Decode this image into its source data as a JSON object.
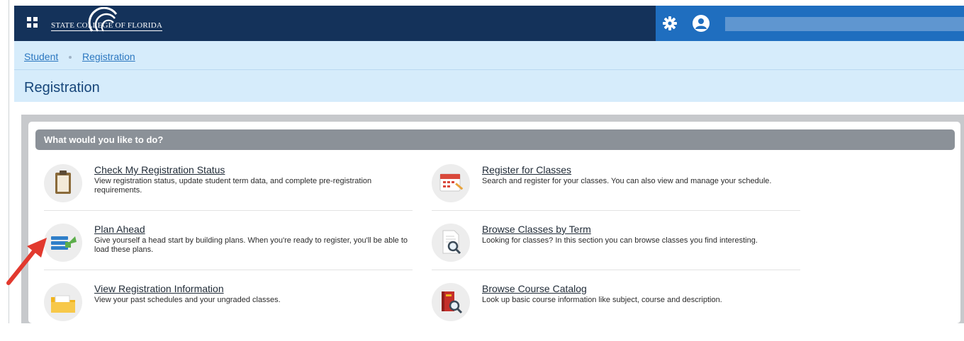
{
  "header": {
    "logo_text": "STATE COLLEGE OF FLORIDA",
    "icons": [
      "apps-grid-icon",
      "gear-icon",
      "user-avatar-icon"
    ],
    "colors": {
      "top_bar": "#14325a",
      "top_bar_right": "#1f6ebf",
      "breadcrumb_bg": "#d6ecfb",
      "panel_header": "#8b9198"
    }
  },
  "breadcrumb": {
    "items": [
      "Student",
      "Registration"
    ]
  },
  "page": {
    "title": "Registration"
  },
  "panel": {
    "heading": "What would you like to do?",
    "items": [
      {
        "title": "Check My Registration Status",
        "description": "View registration status, update student term data, and complete pre-registration requirements.",
        "icon": "clipboard-icon"
      },
      {
        "title": "Register for Classes",
        "description": "Search and register for your classes. You can also view and manage your schedule.",
        "icon": "calendar-icon"
      },
      {
        "title": "Plan Ahead",
        "description": "Give yourself a head start by building plans. When you're ready to register, you'll be able to load these plans.",
        "icon": "plan-list-icon"
      },
      {
        "title": "Browse Classes by Term",
        "description": "Looking for classes? In this section you can browse classes you find interesting.",
        "icon": "document-search-icon"
      },
      {
        "title": "View Registration Information",
        "description": "View your past schedules and your ungraded classes.",
        "icon": "folder-icon"
      },
      {
        "title": "Browse Course Catalog",
        "description": "Look up basic course information like subject, course and description.",
        "icon": "book-search-icon"
      }
    ]
  },
  "annotation": {
    "icon": "red-arrow-icon",
    "color": "#e2392e"
  }
}
